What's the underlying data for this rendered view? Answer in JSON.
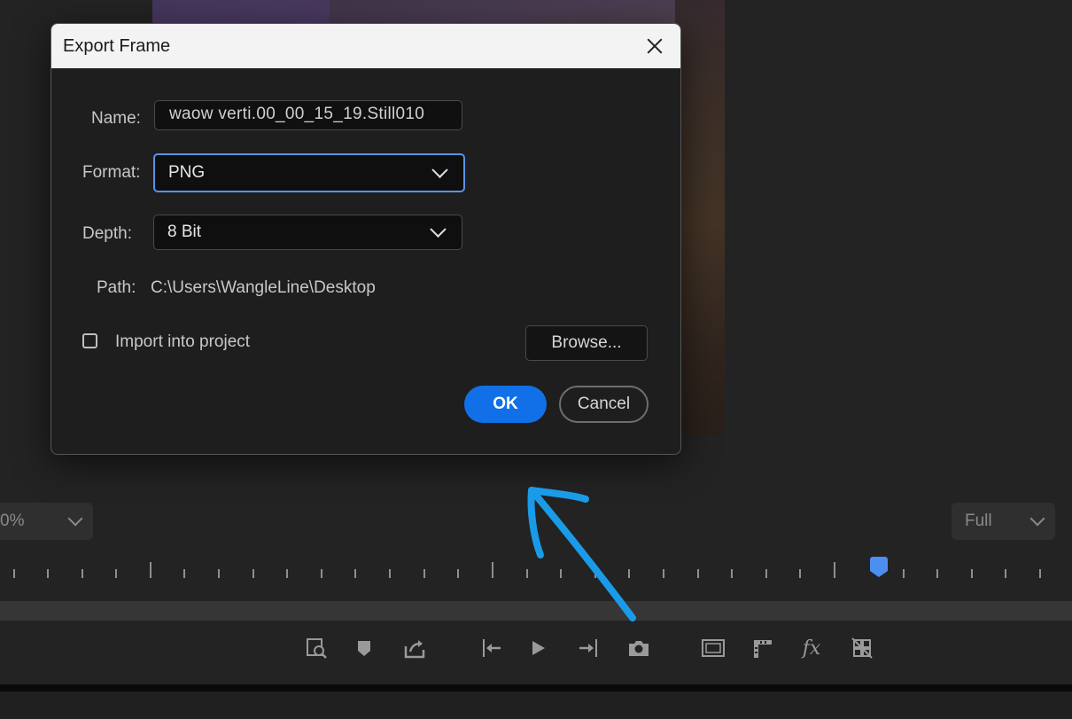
{
  "dialog": {
    "title": "Export Frame",
    "name_label": "Name:",
    "name_value": "waow verti.00_00_15_19.Still010",
    "format_label": "Format:",
    "format_value": "PNG",
    "depth_label": "Depth:",
    "depth_value": "8 Bit",
    "path_label": "Path:",
    "path_value": "C:\\Users\\WangleLine\\Desktop",
    "import_label": "Import into project",
    "import_checked": false,
    "browse_label": "Browse...",
    "ok_label": "OK",
    "cancel_label": "Cancel"
  },
  "monitor": {
    "zoom_value": "0%",
    "quality_value": "Full"
  },
  "transport": {
    "buttons": [
      "find-icon",
      "marker-icon",
      "export-icon",
      "go-to-in-icon",
      "play-icon",
      "go-to-out-icon",
      "camera-icon",
      "safe-margins-icon",
      "film-icon",
      "fx-icon",
      "multicam-icon"
    ]
  },
  "colors": {
    "accent": "#1170e8",
    "annotation": "#1a9be8",
    "playhead": "#4d8ff0",
    "panel": "#232323"
  }
}
